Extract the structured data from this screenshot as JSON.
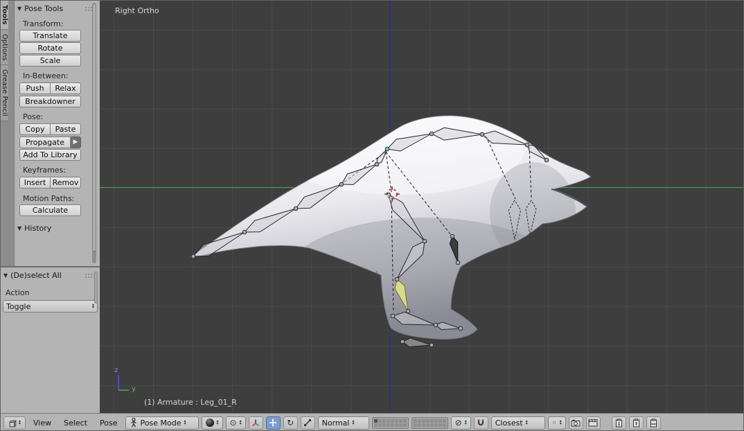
{
  "tabs": {
    "tools": "Tools",
    "options": "Options",
    "grease_pencil": "Grease Pencil"
  },
  "pose_tools": {
    "title": "Pose Tools",
    "transform_label": "Transform:",
    "translate": "Translate",
    "rotate": "Rotate",
    "scale": "Scale",
    "inbetween_label": "In-Between:",
    "push": "Push",
    "relax": "Relax",
    "breakdowner": "Breakdowner",
    "pose_label": "Pose:",
    "copy": "Copy",
    "paste": "Paste",
    "propagate": "Propagate",
    "add_to_library": "Add To Library",
    "keyframes_label": "Keyframes:",
    "insert": "Insert",
    "remove": "Remov",
    "motion_paths_label": "Motion Paths:",
    "calculate": "Calculate"
  },
  "history": {
    "title": "History"
  },
  "deselect": {
    "title": "(De)select All",
    "action_label": "Action",
    "value": "Toggle"
  },
  "viewport": {
    "view_name": "Right Ortho",
    "status": "(1) Armature : Leg_01_R",
    "axis_z": "z",
    "axis_y": "y"
  },
  "header": {
    "view": "View",
    "select": "Select",
    "pose": "Pose",
    "mode": "Pose Mode",
    "orientation": "Normal",
    "snap": "Closest"
  },
  "colors": {
    "selected_bone": "#d9da8c",
    "axis_y": "#4f9e4f",
    "axis_z": "#32327c",
    "active_joint": "#79c4cb"
  }
}
